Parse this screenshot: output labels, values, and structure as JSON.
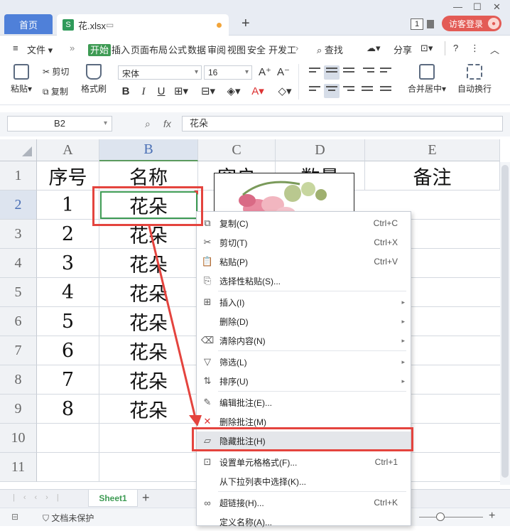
{
  "tabs": {
    "home": "首页",
    "file": "花.xlsx",
    "add": "+"
  },
  "window": {
    "badge": "1",
    "login": "访客登录"
  },
  "menu": {
    "file": "文件",
    "items": [
      "开始",
      "插入",
      "页面布局",
      "公式",
      "数据",
      "审阅",
      "视图",
      "安全",
      "开发工"
    ],
    "search": "查找",
    "share": "分享",
    "help": "?"
  },
  "ribbon": {
    "paste": "粘贴",
    "cut": "剪切",
    "copy": "复制",
    "format_painter": "格式刷",
    "font_name": "宋体",
    "font_size": "16",
    "merge": "合并居中",
    "wrap": "自动换行"
  },
  "formula_bar": {
    "cell_ref": "B2",
    "fx": "fx",
    "value": "花朵"
  },
  "grid": {
    "columns": [
      "A",
      "B",
      "C",
      "D",
      "E"
    ],
    "rows": [
      "1",
      "2",
      "3",
      "4",
      "5",
      "6",
      "7",
      "8",
      "9",
      "10",
      "11"
    ],
    "header_row": [
      "序号",
      "名称",
      "穿户",
      "数量",
      "备注"
    ],
    "data": [
      [
        "1",
        "花朵"
      ],
      [
        "2",
        "花朵"
      ],
      [
        "3",
        "花朵"
      ],
      [
        "4",
        "花朵"
      ],
      [
        "5",
        "花朵"
      ],
      [
        "6",
        "花朵"
      ],
      [
        "7",
        "花朵"
      ],
      [
        "8",
        "花朵"
      ]
    ],
    "selected_cell": "B2"
  },
  "sheet_tabs": {
    "active": "Sheet1"
  },
  "status": {
    "protect": "文档未保护"
  },
  "context_menu": [
    {
      "label": "复制(C)",
      "shortcut": "Ctrl+C",
      "icon": "copy-icon"
    },
    {
      "label": "剪切(T)",
      "shortcut": "Ctrl+X",
      "icon": "scissors-icon"
    },
    {
      "label": "粘贴(P)",
      "shortcut": "Ctrl+V",
      "icon": "paste-icon"
    },
    {
      "label": "选择性粘贴(S)...",
      "shortcut": "",
      "icon": "paste-special-icon"
    },
    {
      "label": "插入(I)",
      "shortcut": "",
      "icon": "insert-icon",
      "submenu": true
    },
    {
      "label": "删除(D)",
      "shortcut": "",
      "icon": "",
      "submenu": true
    },
    {
      "label": "清除内容(N)",
      "shortcut": "",
      "icon": "eraser-icon",
      "submenu": true
    },
    {
      "label": "筛选(L)",
      "shortcut": "",
      "icon": "filter-icon",
      "submenu": true
    },
    {
      "label": "排序(U)",
      "shortcut": "",
      "icon": "sort-icon",
      "submenu": true
    },
    {
      "label": "编辑批注(E)...",
      "shortcut": "",
      "icon": "edit-comment-icon"
    },
    {
      "label": "删除批注(M)",
      "shortcut": "",
      "icon": "delete-comment-icon"
    },
    {
      "label": "隐藏批注(H)",
      "shortcut": "",
      "icon": "hide-comment-icon",
      "highlighted": true
    },
    {
      "label": "设置单元格格式(F)...",
      "shortcut": "Ctrl+1",
      "icon": "format-cells-icon"
    },
    {
      "label": "从下拉列表中选择(K)...",
      "shortcut": "",
      "icon": ""
    },
    {
      "label": "超链接(H)...",
      "shortcut": "Ctrl+K",
      "icon": "link-icon"
    },
    {
      "label": "定义名称(A)...",
      "shortcut": "",
      "icon": ""
    }
  ],
  "colors": {
    "accent": "#3e9b54",
    "highlight_red": "#e4443e",
    "home_tab": "#4f80d9"
  }
}
